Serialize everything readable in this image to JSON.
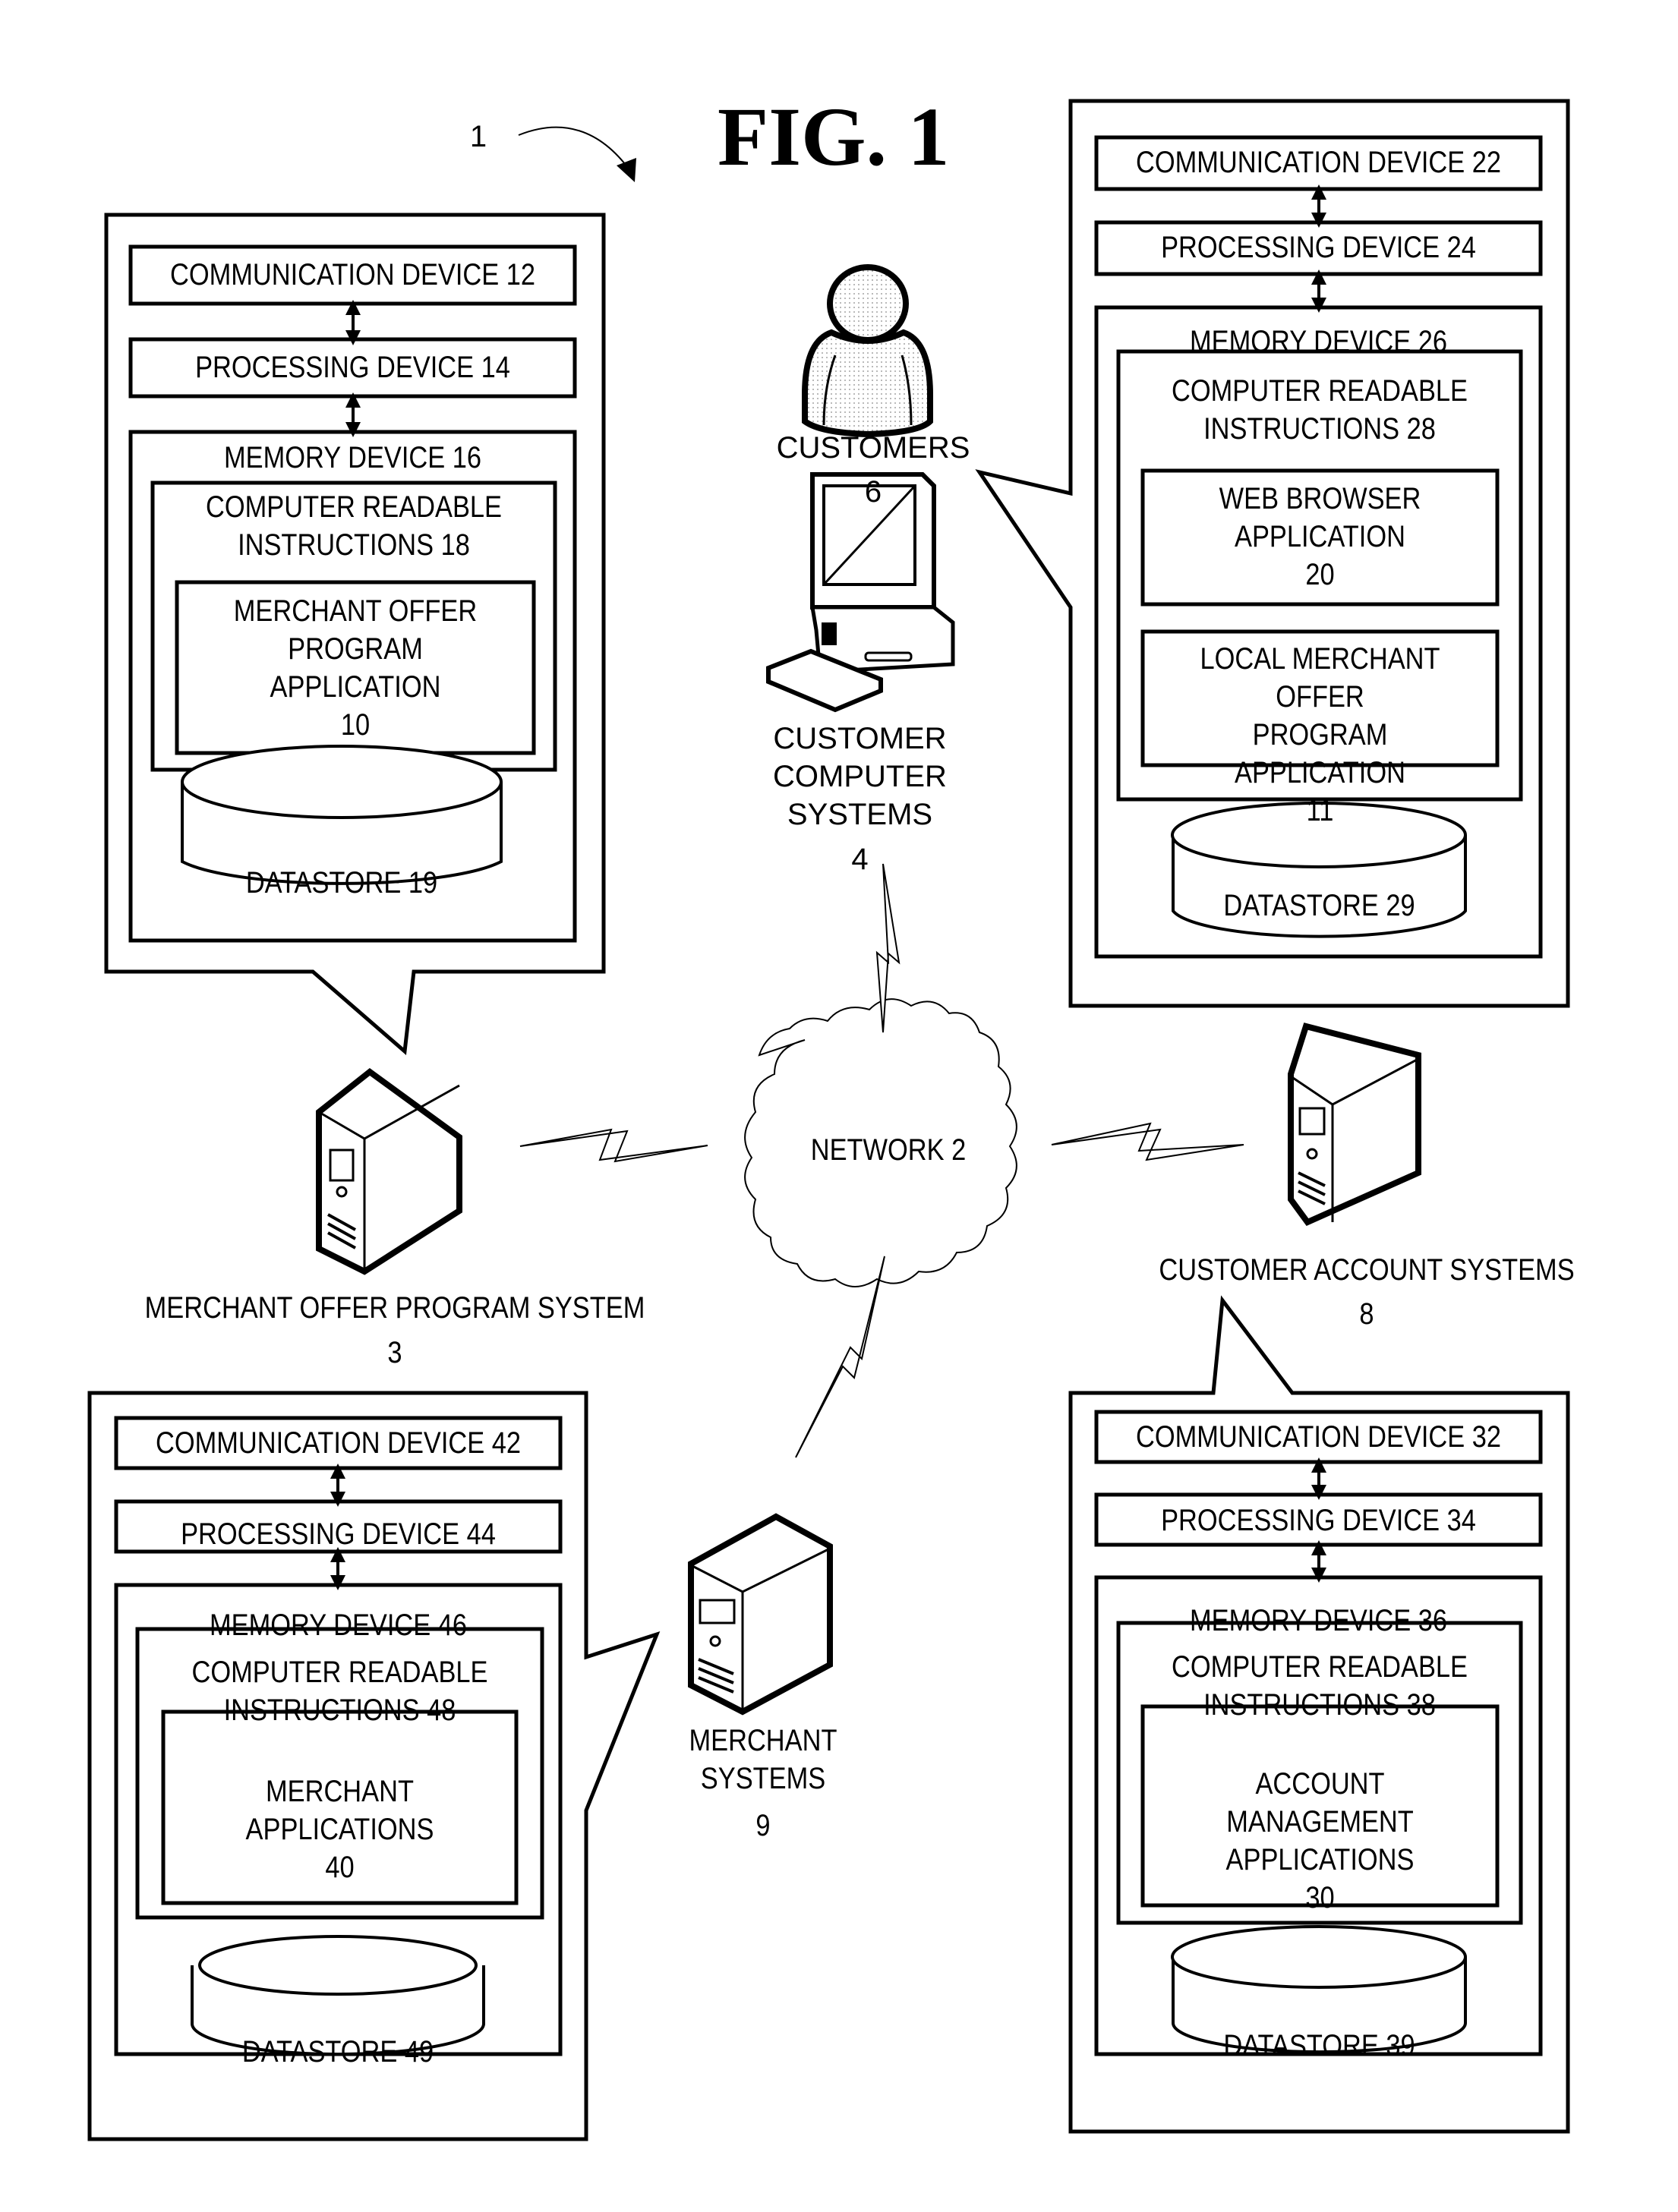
{
  "figure": {
    "title": "FIG. 1",
    "system_ref": "1"
  },
  "network": {
    "label": "NETWORK 2"
  },
  "entities": {
    "customers": {
      "label": "CUSTOMERS",
      "ref": "6"
    },
    "customer_computer_systems": {
      "label": "CUSTOMER\nCOMPUTER\nSYSTEMS",
      "ref": "4"
    },
    "merchant_offer_program_system": {
      "label": "MERCHANT OFFER PROGRAM SYSTEM",
      "ref": "3"
    },
    "customer_account_systems": {
      "label": "CUSTOMER ACCOUNT SYSTEMS",
      "ref": "8"
    },
    "merchant_systems": {
      "label": "MERCHANT\nSYSTEMS",
      "ref": "9"
    }
  },
  "callouts": {
    "mops": {
      "communication": "COMMUNICATION DEVICE 12",
      "processing": "PROCESSING DEVICE 14",
      "memory": "MEMORY DEVICE 16",
      "instructions": "COMPUTER READABLE\nINSTRUCTIONS 18",
      "apps": [
        "MERCHANT OFFER\nPROGRAM\nAPPLICATION\n10"
      ],
      "datastore": "DATASTORE 19"
    },
    "customer_computer": {
      "communication": "COMMUNICATION DEVICE 22",
      "processing": "PROCESSING DEVICE 24",
      "memory": "MEMORY DEVICE 26",
      "instructions": "COMPUTER READABLE\nINSTRUCTIONS 28",
      "apps": [
        "WEB BROWSER\nAPPLICATION\n20",
        "LOCAL MERCHANT OFFER\nPROGRAM APPLICATION\n11"
      ],
      "datastore": "DATASTORE 29"
    },
    "merchant": {
      "communication": "COMMUNICATION DEVICE 42",
      "processing": "PROCESSING DEVICE 44",
      "memory": "MEMORY DEVICE 46",
      "instructions": "COMPUTER READABLE\nINSTRUCTIONS 48",
      "apps": [
        "MERCHANT\nAPPLICATIONS\n40"
      ],
      "datastore": "DATASTORE 49"
    },
    "customer_account": {
      "communication": "COMMUNICATION DEVICE 32",
      "processing": "PROCESSING DEVICE 34",
      "memory": "MEMORY DEVICE 36",
      "instructions": "COMPUTER READABLE\nINSTRUCTIONS 38",
      "apps": [
        "ACCOUNT MANAGEMENT\nAPPLICATIONS\n30"
      ],
      "datastore": "DATASTORE 39"
    }
  }
}
